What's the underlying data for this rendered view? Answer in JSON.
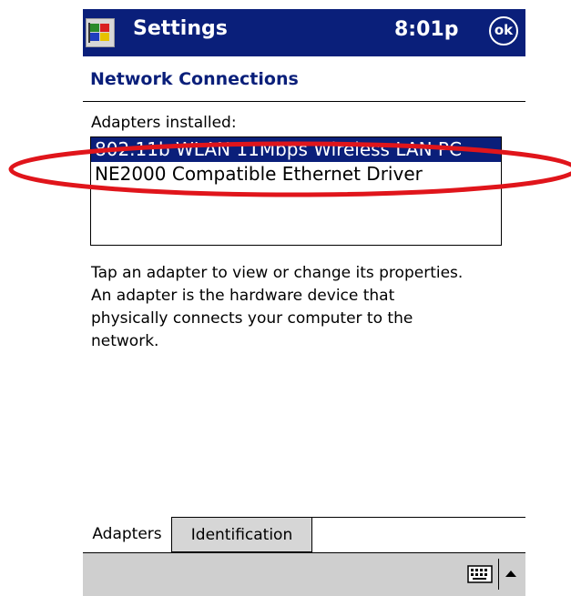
{
  "titlebar": {
    "app_title": "Settings",
    "clock": "8:01p",
    "ok_label": "ok",
    "start_icon": "windows-flag-icon"
  },
  "page": {
    "heading": "Network Connections"
  },
  "adapters": {
    "label": "Adapters installed:",
    "items": [
      {
        "label": "802.11b WLAN 11Mbps Wireless LAN PC"
      },
      {
        "label": "NE2000 Compatible Ethernet Driver"
      }
    ],
    "selected_index": 0
  },
  "description": "Tap an adapter to view or change its properties. An adapter is the hardware device that physically connects your computer to the network.",
  "tabs": [
    {
      "label": "Adapters",
      "active": true
    },
    {
      "label": "Identification",
      "active": false
    }
  ],
  "menubar": {
    "keyboard_icon": "keyboard-icon",
    "sip_arrow_icon": "up-arrow-icon"
  },
  "colors": {
    "titlebar": "#0a1f7a",
    "selection": "#0a1f7a",
    "annotation": "#e0151b",
    "menubar": "#cfcfcf"
  }
}
